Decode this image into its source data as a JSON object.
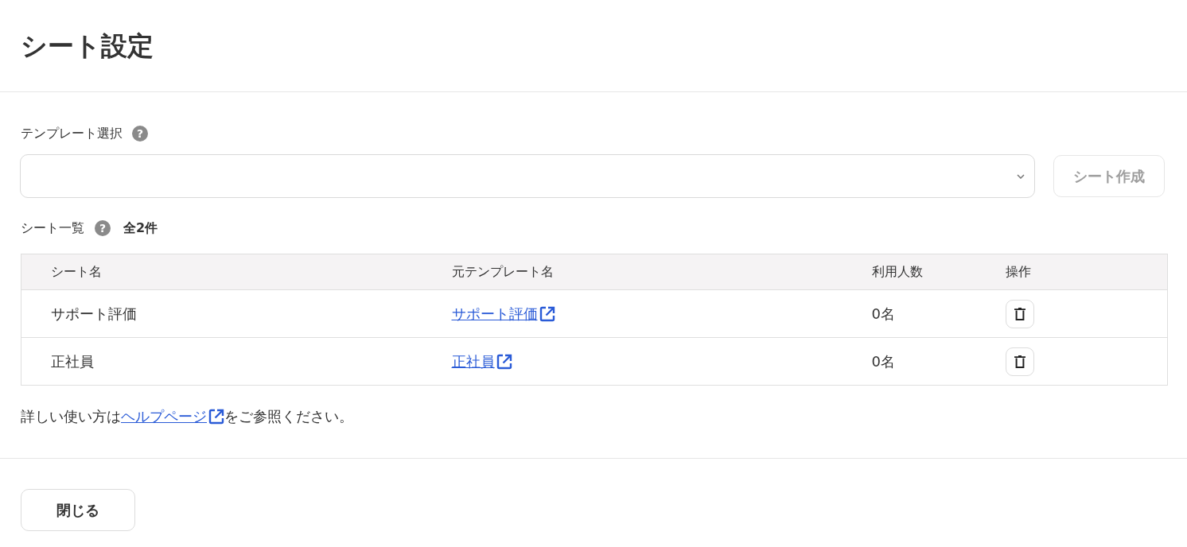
{
  "page_title": "シート設定",
  "template_select": {
    "label": "テンプレート選択",
    "help_icon": "?"
  },
  "create_button": {
    "label": "シート作成",
    "disabled": true
  },
  "sheet_list": {
    "label": "シート一覧",
    "help_icon": "?",
    "count": "全2件"
  },
  "table": {
    "columns": [
      "シート名",
      "元テンプレート名",
      "利用人数",
      "操作"
    ],
    "rows": [
      {
        "sheet_name": "サポート評価",
        "template_name": "サポート評価",
        "users": "0名"
      },
      {
        "sheet_name": "正社員",
        "template_name": "正社員",
        "users": "0名"
      }
    ]
  },
  "help_note": {
    "before": "詳しい使い方は",
    "link": "ヘルプページ",
    "after": "をご参照ください。"
  },
  "close_button": {
    "label": "閉じる"
  }
}
